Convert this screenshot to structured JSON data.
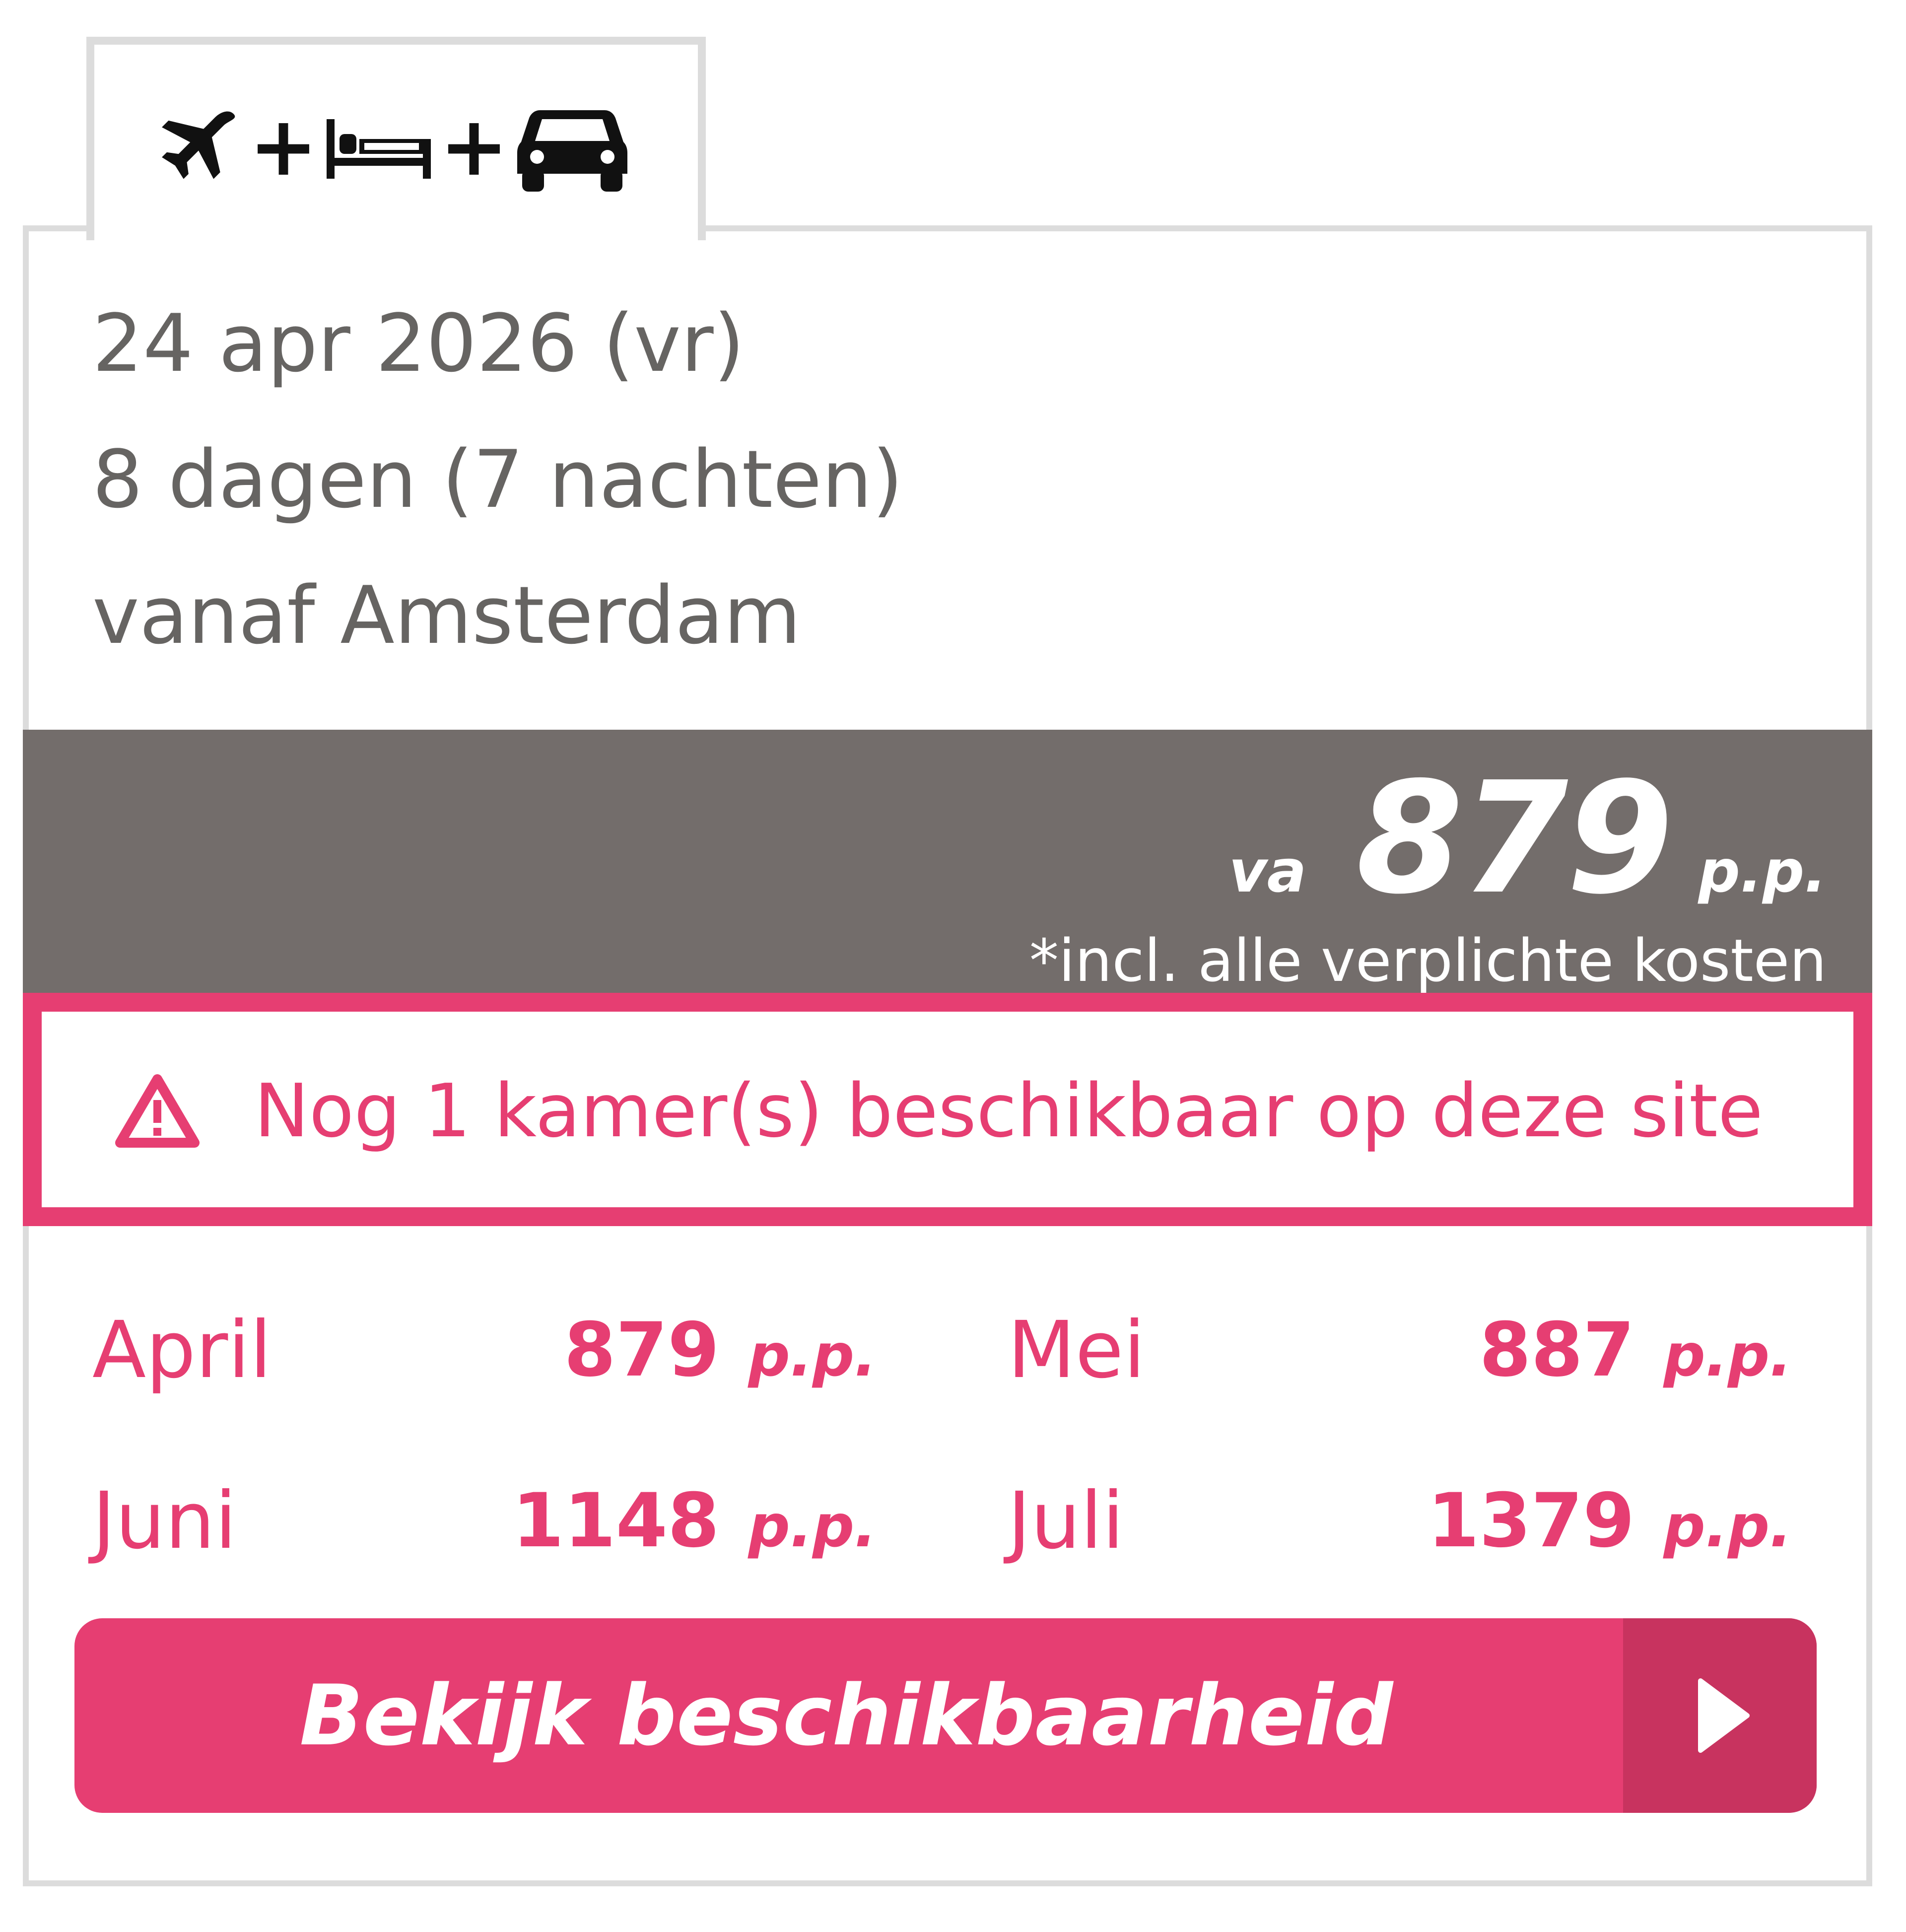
{
  "tab": {
    "icons": [
      "plane-icon",
      "plus",
      "bed-icon",
      "plus",
      "car-icon"
    ]
  },
  "info": {
    "date": "24 apr 2026 (vr)",
    "duration": "8 dagen (7 nachten)",
    "departure": "vanaf Amsterdam"
  },
  "price": {
    "prefix": "va",
    "amount": "879",
    "suffix": "p.p.",
    "note": "*incl. alle verplichte kosten"
  },
  "alert": {
    "icon": "warning-icon",
    "text": "Nog 1 kamer(s) beschikbaar op deze site"
  },
  "months": [
    {
      "name": "April",
      "price": "879",
      "suffix": "p.p."
    },
    {
      "name": "Mei",
      "price": "887",
      "suffix": "p.p."
    },
    {
      "name": "Juni",
      "price": "1148",
      "suffix": "p.p."
    },
    {
      "name": "Juli",
      "price": "1379",
      "suffix": "p.p."
    }
  ],
  "cta": {
    "label": "Bekijk beschikbaarheid",
    "icon": "chevron-right-icon"
  },
  "colors": {
    "accent": "#e63e72",
    "accent_dark": "#c8335f",
    "band": "#736d6b",
    "text_gray": "#666462",
    "border": "#dcdcdc"
  }
}
